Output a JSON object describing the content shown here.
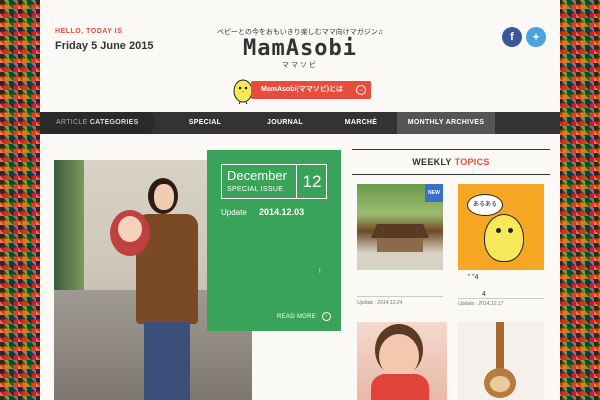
{
  "header": {
    "greeting": "HELLO, TODAY IS",
    "date": "Friday 5 June 2015",
    "tagline": "ベビーとの今をおもいきり楽しむママ向けマガジン♫",
    "logo": "MamAsobi",
    "logo_sub": "ママソビ",
    "about_button": "MamAsobi(ママソビ)とは",
    "social": [
      "facebook-icon",
      "twitter-icon"
    ]
  },
  "nav": {
    "categories_prefix": "ARTICLE",
    "categories_label": "CATEGORIES",
    "items": [
      "SPECIAL",
      "JOURNAL",
      "MARCHÉ",
      "MONTHLY ARCHIVES"
    ],
    "active": "MONTHLY ARCHIVES"
  },
  "feature": {
    "month": "December",
    "special": "SPECIAL ISSUE",
    "number": "12",
    "update_label": "Update",
    "update_date": "2014.12.03",
    "mark": "!",
    "read_more": "READ MORE"
  },
  "weekly": {
    "title_a": "WEEKLY",
    "title_b": "TOPICS",
    "items": [
      {
        "badge": "NEW",
        "caption": "",
        "stamp": "Update : 2014.12.24"
      },
      {
        "bubble": "あるある",
        "caption": "”    ”4",
        "caption2": "4",
        "stamp": "Update : 2014.12.17"
      }
    ]
  },
  "colors": {
    "accent": "#e84c3d",
    "nav": "#333333",
    "feature": "#3aa35a",
    "facebook": "#3b5998",
    "twitter": "#4aa3df"
  }
}
